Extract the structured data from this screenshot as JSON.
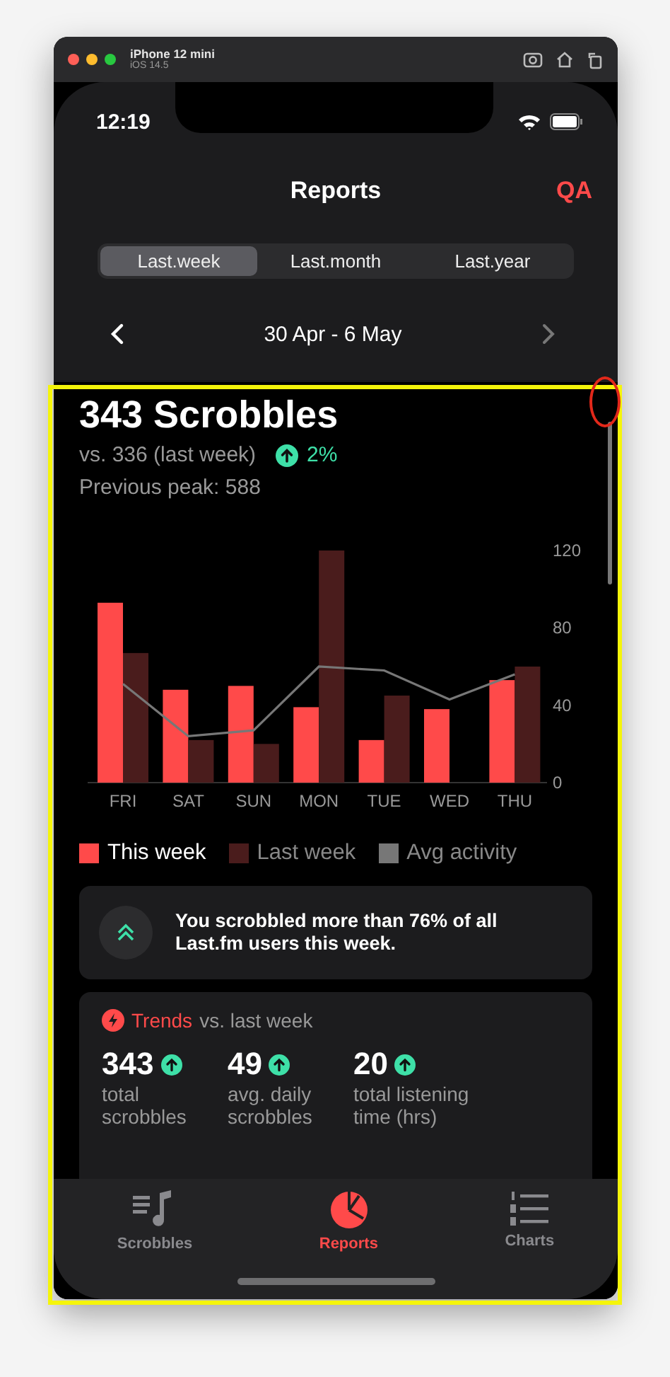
{
  "device": {
    "name": "iPhone 12 mini",
    "os": "iOS 14.5"
  },
  "status_bar": {
    "time": "12:19"
  },
  "nav": {
    "title": "Reports",
    "action": "QA"
  },
  "period_tabs": [
    {
      "label": "Last.week",
      "selected": true
    },
    {
      "label": "Last.month",
      "selected": false
    },
    {
      "label": "Last.year",
      "selected": false
    }
  ],
  "date_range": {
    "label": "30 Apr - 6 May"
  },
  "summary": {
    "headline": "343 Scrobbles",
    "comparison": "vs. 336 (last week)",
    "change": "2%",
    "peak": "Previous peak: 588"
  },
  "chart_data": {
    "type": "bar",
    "categories": [
      "FRI",
      "SAT",
      "SUN",
      "MON",
      "TUE",
      "WED",
      "THU"
    ],
    "ylim": [
      0,
      120
    ],
    "yticks": [
      0,
      40,
      80,
      120
    ],
    "series": [
      {
        "name": "This week",
        "color": "#ff4a4a",
        "values": [
          93,
          48,
          50,
          39,
          22,
          38,
          53
        ]
      },
      {
        "name": "Last week",
        "color": "#4a1c1c",
        "values": [
          67,
          22,
          20,
          120,
          45,
          0,
          60
        ]
      },
      {
        "name": "Avg activity",
        "color": "#777777",
        "type": "line",
        "values": [
          51,
          24,
          27,
          60,
          58,
          43,
          56
        ]
      }
    ]
  },
  "percentile_card": {
    "text": "You scrobbled more than 76% of all Last.fm users this week."
  },
  "trends": {
    "title": "Trends",
    "subtitle": "vs. last week",
    "stats": [
      {
        "value": "343",
        "label": "total scrobbles"
      },
      {
        "value": "49",
        "label": "avg. daily scrobbles"
      },
      {
        "value": "20",
        "label": "total listening time (hrs)"
      }
    ]
  },
  "tab_bar": [
    {
      "label": "Scrobbles",
      "kind": "scrobbles",
      "selected": false
    },
    {
      "label": "Reports",
      "kind": "reports",
      "selected": true
    },
    {
      "label": "Charts",
      "kind": "charts",
      "selected": false
    }
  ]
}
